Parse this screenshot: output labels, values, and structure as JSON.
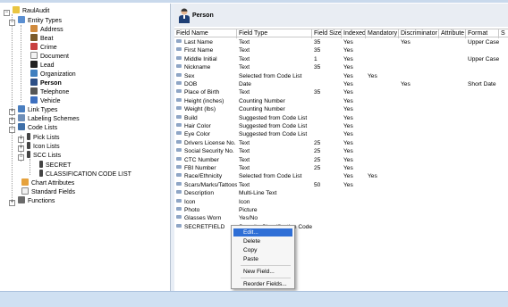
{
  "tree": {
    "root": "RaulAudit",
    "entity_types": {
      "label": "Entity Types",
      "children": [
        "Address",
        "Beat",
        "Crime",
        "Document",
        "Lead",
        "Organization",
        "Person",
        "Telephone",
        "Vehicle"
      ],
      "selected": "Person"
    },
    "link_types": "Link Types",
    "labeling_schemes": "Labeling Schemes",
    "code_lists": {
      "label": "Code Lists",
      "children": [
        "Pick Lists",
        "Icon Lists",
        "SCC Lists"
      ],
      "scc_children": [
        "SECRET",
        "CLASSIFICATION CODE LIST"
      ]
    },
    "chart_attributes": "Chart Attributes",
    "standard_fields": "Standard Fields",
    "functions": "Functions"
  },
  "entity_header": {
    "title": "Person"
  },
  "grid": {
    "columns": [
      "Field Name",
      "Field Type",
      "Field Size",
      "Indexed",
      "Mandatory",
      "Discriminator",
      "Attribute",
      "Format",
      "S"
    ],
    "rows": [
      [
        "Last Name",
        "Text",
        "35",
        "Yes",
        "",
        "Yes",
        "",
        "Upper Case"
      ],
      [
        "First Name",
        "Text",
        "35",
        "Yes",
        "",
        "",
        "",
        ""
      ],
      [
        "Middle Initial",
        "Text",
        "1",
        "Yes",
        "",
        "",
        "",
        "Upper Case"
      ],
      [
        "Nickname",
        "Text",
        "35",
        "Yes",
        "",
        "",
        "",
        ""
      ],
      [
        "Sex",
        "Selected from Code List",
        "",
        "Yes",
        "Yes",
        "",
        "",
        ""
      ],
      [
        "DOB",
        "Date",
        "",
        "Yes",
        "",
        "Yes",
        "",
        "Short Date"
      ],
      [
        "Place of Birth",
        "Text",
        "35",
        "Yes",
        "",
        "",
        "",
        ""
      ],
      [
        "Height (inches)",
        "Counting Number",
        "",
        "Yes",
        "",
        "",
        "",
        ""
      ],
      [
        "Weight (lbs)",
        "Counting Number",
        "",
        "Yes",
        "",
        "",
        "",
        ""
      ],
      [
        "Build",
        "Suggested from Code List",
        "",
        "Yes",
        "",
        "",
        "",
        ""
      ],
      [
        "Hair Color",
        "Suggested from Code List",
        "",
        "Yes",
        "",
        "",
        "",
        ""
      ],
      [
        "Eye Color",
        "Suggested from Code List",
        "",
        "Yes",
        "",
        "",
        "",
        ""
      ],
      [
        "Drivers License No.",
        "Text",
        "25",
        "Yes",
        "",
        "",
        "",
        ""
      ],
      [
        "Social Security No.",
        "Text",
        "25",
        "Yes",
        "",
        "",
        "",
        ""
      ],
      [
        "CTC Number",
        "Text",
        "25",
        "Yes",
        "",
        "",
        "",
        ""
      ],
      [
        "FBI Number",
        "Text",
        "25",
        "Yes",
        "",
        "",
        "",
        ""
      ],
      [
        "Race/Ethnicity",
        "Selected from Code List",
        "",
        "Yes",
        "Yes",
        "",
        "",
        ""
      ],
      [
        "Scars/Marks/Tattoos",
        "Text",
        "50",
        "Yes",
        "",
        "",
        "",
        ""
      ],
      [
        "Description",
        "Multi-Line Text",
        "",
        "",
        "",
        "",
        "",
        ""
      ],
      [
        "Icon",
        "Icon",
        "",
        "",
        "",
        "",
        "",
        ""
      ],
      [
        "Photo",
        "Picture",
        "",
        "",
        "",
        "",
        "",
        ""
      ],
      [
        "Glasses Worn",
        "Yes/No",
        "",
        "",
        "",
        "",
        "",
        ""
      ],
      [
        "SECRETFIELD",
        "Security Classification Code",
        "",
        "",
        "",
        "",
        "",
        ""
      ]
    ]
  },
  "context_menu": {
    "items": [
      "Edit...",
      "Delete",
      "Copy",
      "Paste",
      "New Field...",
      "Reorder Fields..."
    ],
    "highlighted": "Edit..."
  },
  "colors": {
    "accent": "#2f6fd6",
    "header_band": "#e9edf3",
    "statusbar": "#cfe0f2"
  }
}
